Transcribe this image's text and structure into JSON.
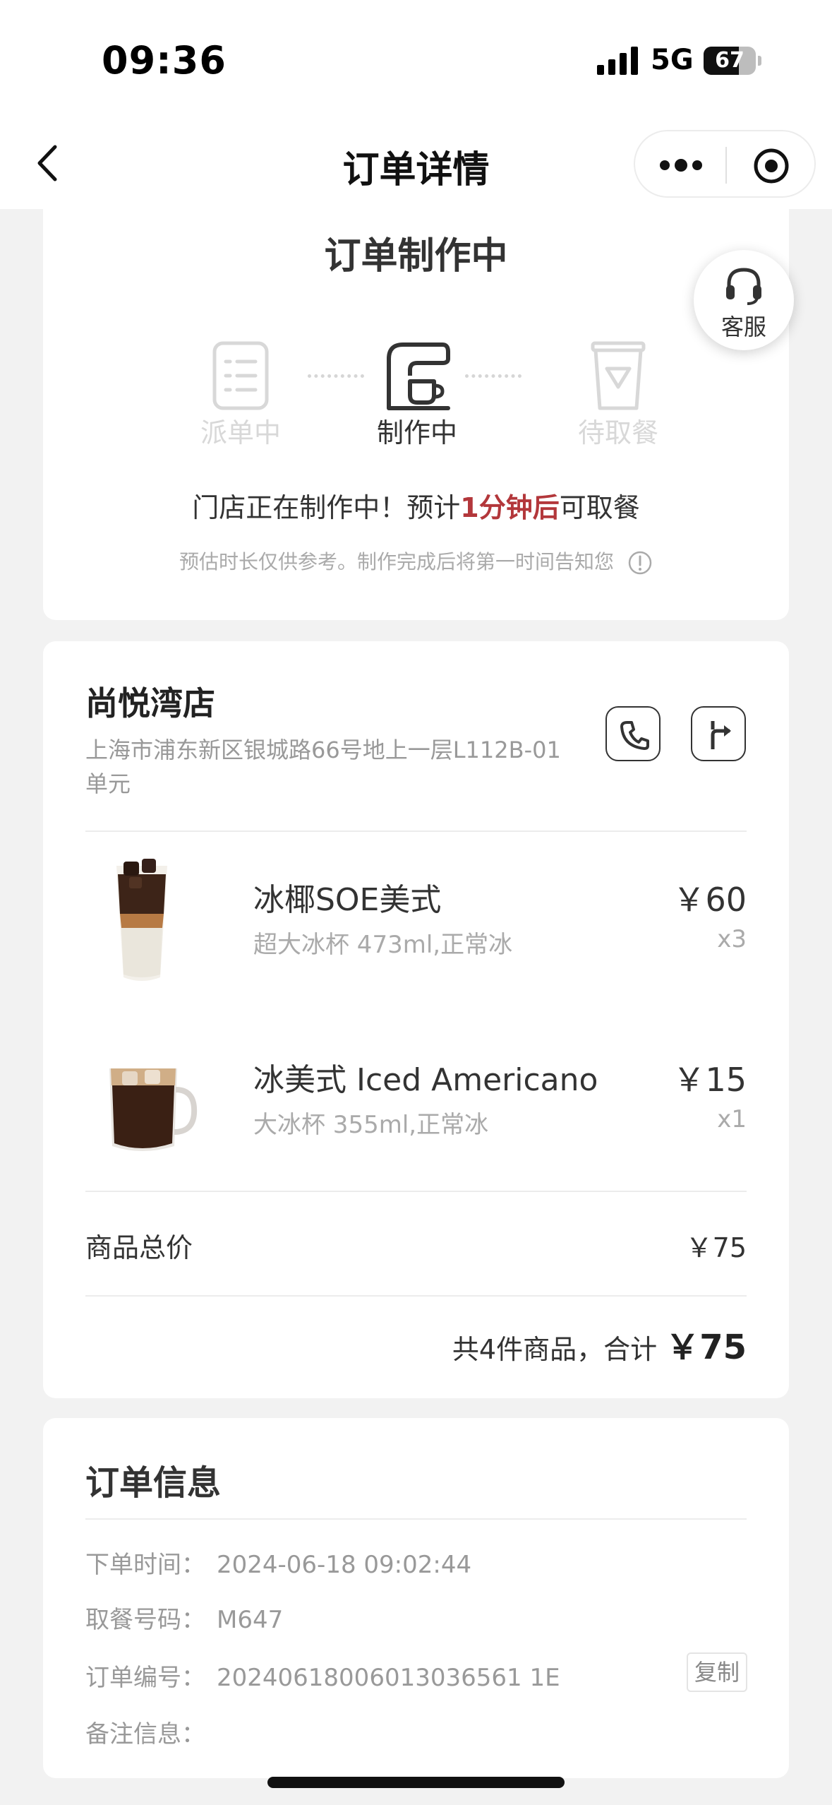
{
  "status_bar": {
    "time": "09:36",
    "network": "5G",
    "battery": "67",
    "battery_level": 0.67
  },
  "nav": {
    "title": "订单详情"
  },
  "progress": {
    "title": "订单制作中",
    "service_label": "客服",
    "steps": [
      "派单中",
      "制作中",
      "待取餐"
    ],
    "active_step": 1,
    "message_prefix": "门店正在制作中！预计",
    "message_highlight": "1分钟后",
    "message_suffix": "可取餐",
    "hint": "预估时长仅供参考。制作完成后将第一时间告知您",
    "accent_color": "#b3373b"
  },
  "store": {
    "name": "尚悦湾店",
    "address": "上海市浦东新区银城路66号地上一层L112B-01单元"
  },
  "items": [
    {
      "name": "冰椰SOE美式",
      "spec": "超大冰杯 473ml,正常冰",
      "price": "￥60",
      "qty": "x3"
    },
    {
      "name": "冰美式 Iced Americano",
      "spec": "大冰杯 355ml,正常冰",
      "price": "￥15",
      "qty": "x1"
    }
  ],
  "summary": {
    "subtotal_label": "商品总价",
    "subtotal_value": "￥75",
    "total_prefix": "共4件商品，合计",
    "total_value": "￥75"
  },
  "order_info": {
    "title": "订单信息",
    "rows": [
      {
        "label": "下单时间：",
        "value": "2024-06-18 09:02:44"
      },
      {
        "label": "取餐号码：",
        "value": "M647"
      },
      {
        "label": "订单编号：",
        "value": "20240618006013036561 1E"
      },
      {
        "label": "备注信息：",
        "value": ""
      }
    ],
    "copy_label": "复制"
  }
}
